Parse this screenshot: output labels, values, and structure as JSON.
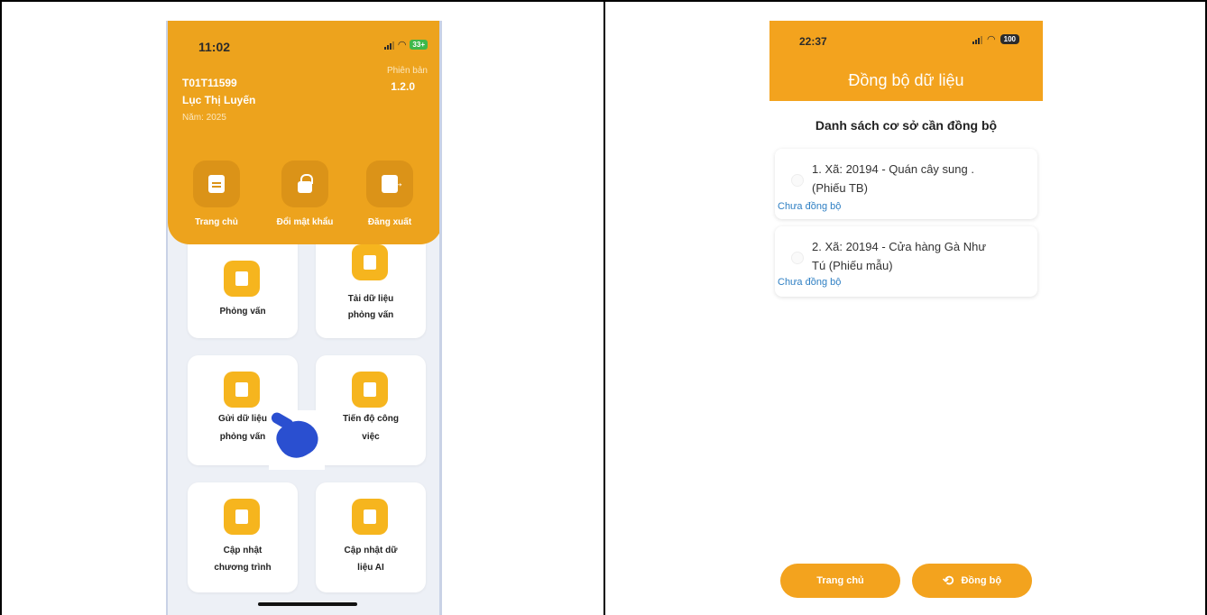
{
  "left_screen": {
    "status_bar": {
      "time": "11:02",
      "battery": "33+"
    },
    "user": {
      "code": "T01T11599",
      "name": "Lục Thị Luyến",
      "year": "Năm: 2025"
    },
    "version": {
      "label": "Phiên bản",
      "value": "1.2.0"
    },
    "header_actions": [
      {
        "label": "Trang chủ",
        "icon": "document-icon"
      },
      {
        "label": "Đổi mật khẩu",
        "icon": "lock-icon"
      },
      {
        "label": "Đăng xuất",
        "icon": "logout-icon"
      }
    ],
    "menu": [
      {
        "line1": "Phỏng vấn",
        "line2": "",
        "icon": "interview-doc-icon"
      },
      {
        "line1": "Tải dữ liệu",
        "line2": "phỏng vấn",
        "icon": "download-icon"
      },
      {
        "line1": "Gửi dữ liệu",
        "line2": "phỏng vấn",
        "icon": "sync-icon"
      },
      {
        "line1": "Tiến độ công",
        "line2": "việc",
        "icon": "progress-chart-icon"
      },
      {
        "line1": "Cập nhật",
        "line2": "chương trình",
        "icon": "update-icon"
      },
      {
        "line1": "Cập nhật dữ",
        "line2": "liệu AI",
        "icon": "building-icon"
      }
    ]
  },
  "right_screen": {
    "status_bar": {
      "time": "22:37",
      "battery": "100"
    },
    "title": "Đồng bộ dữ liệu",
    "list_heading": "Danh sách cơ sở cần đồng bộ",
    "items": [
      {
        "line1": "1. Xã: 20194 - Quán cây sung .",
        "line2": "(Phiếu TB)",
        "status": "Chưa đồng bộ"
      },
      {
        "line1": "2. Xã: 20194 -  Cửa hàng Gà Như",
        "line2": "Tú (Phiếu mẫu)",
        "status": "Chưa đồng bộ"
      }
    ],
    "buttons": {
      "home": "Trang chủ",
      "sync": "Đồng bộ"
    }
  },
  "colors": {
    "accent": "#eda31d",
    "status_text": "#2e7fc3",
    "icon_bg": "#f6b51e"
  }
}
